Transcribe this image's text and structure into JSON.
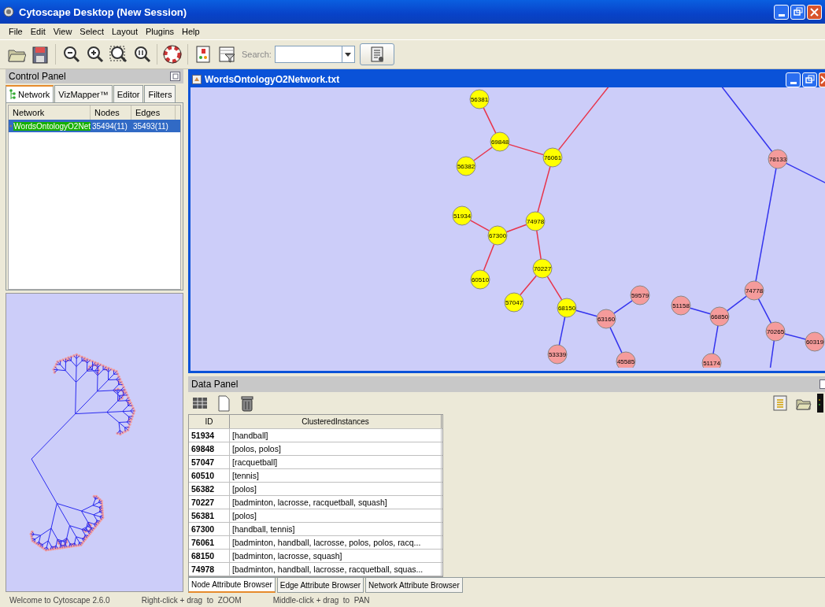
{
  "window": {
    "title": "Cytoscape Desktop (New Session)"
  },
  "menu": [
    "File",
    "Edit",
    "View",
    "Select",
    "Layout",
    "Plugins",
    "Help"
  ],
  "toolbar": {
    "search_label": "Search:"
  },
  "control_panel": {
    "title": "Control Panel",
    "tabs": [
      {
        "label": "Network",
        "selected": true
      },
      {
        "label": "VizMapper™",
        "selected": false
      },
      {
        "label": "Editor",
        "selected": false
      },
      {
        "label": "Filters",
        "selected": false
      }
    ],
    "table": {
      "columns": [
        "Network",
        "Nodes",
        "Edges"
      ],
      "rows": [
        {
          "cells": [
            "WordsOntologyO2Net",
            "35494(11)",
            "35493(11)"
          ],
          "selected": true
        }
      ]
    }
  },
  "network_window": {
    "title": "WordsOntologyO2Network.txt",
    "nodes": [
      {
        "label": "56381",
        "selected": true
      },
      {
        "label": "69848",
        "selected": true
      },
      {
        "label": "56382",
        "selected": true
      },
      {
        "label": "76061",
        "selected": true
      },
      {
        "label": "51934",
        "selected": true
      },
      {
        "label": "74978",
        "selected": true
      },
      {
        "label": "67300",
        "selected": true
      },
      {
        "label": "70227",
        "selected": true
      },
      {
        "label": "60510",
        "selected": true
      },
      {
        "label": "57047",
        "selected": true
      },
      {
        "label": "68150",
        "selected": true
      },
      {
        "label": "63160",
        "selected": false
      },
      {
        "label": "59579",
        "selected": false
      },
      {
        "label": "53339",
        "selected": false
      },
      {
        "label": "45585",
        "selected": false
      },
      {
        "label": "51158",
        "selected": false
      },
      {
        "label": "66850",
        "selected": false
      },
      {
        "label": "74778",
        "selected": false
      },
      {
        "label": "70265",
        "selected": false
      },
      {
        "label": "60319",
        "selected": false
      },
      {
        "label": "51174",
        "selected": false
      },
      {
        "label": "78133",
        "selected": false
      }
    ],
    "edges": [
      {
        "selected": true
      },
      {
        "selected": true
      },
      {
        "selected": true
      },
      {
        "selected": true
      },
      {
        "selected": true
      },
      {
        "selected": true
      },
      {
        "selected": true
      },
      {
        "selected": true
      },
      {
        "selected": true
      },
      {
        "selected": true
      },
      {
        "selected": true
      },
      {
        "selected": false
      },
      {
        "selected": false
      },
      {
        "selected": false
      },
      {
        "selected": false
      },
      {
        "selected": false
      },
      {
        "selected": false
      },
      {
        "selected": false
      },
      {
        "selected": false
      },
      {
        "selected": false
      },
      {
        "selected": false
      },
      {
        "selected": false
      },
      {
        "selected": false
      },
      {
        "selected": false
      }
    ]
  },
  "data_panel": {
    "title": "Data Panel",
    "table": {
      "columns": [
        "ID",
        "ClusteredInstances"
      ],
      "rows": [
        [
          "51934",
          "[handball]"
        ],
        [
          "69848",
          "[polos, polos]"
        ],
        [
          "57047",
          "[racquetball]"
        ],
        [
          "60510",
          "[tennis]"
        ],
        [
          "56382",
          "[polos]"
        ],
        [
          "70227",
          "[badminton, lacrosse, racquetball, squash]"
        ],
        [
          "56381",
          "[polos]"
        ],
        [
          "67300",
          "[handball, tennis]"
        ],
        [
          "76061",
          "[badminton, handball, lacrosse, polos, polos, racq..."
        ],
        [
          "68150",
          "[badminton, lacrosse, squash]"
        ],
        [
          "74978",
          "[badminton, handball, lacrosse, racquetball, squas..."
        ]
      ]
    },
    "tabs": [
      {
        "label": "Node Attribute Browser",
        "selected": true
      },
      {
        "label": "Edge Attribute Browser",
        "selected": false
      },
      {
        "label": "Network Attribute Browser",
        "selected": false
      }
    ]
  },
  "status_bar": [
    "Welcome to Cytoscape 2.6.0",
    "Right-click + drag  to  ZOOM",
    "Middle-click + drag  to  PAN"
  ]
}
